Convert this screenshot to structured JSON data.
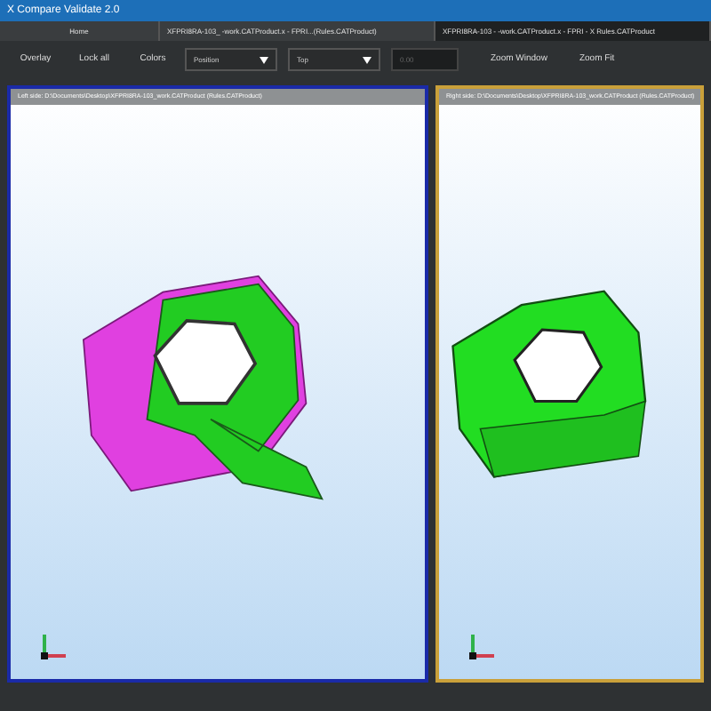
{
  "window": {
    "title": "X Compare Validate 2.0"
  },
  "tabs": [
    {
      "label": "Home",
      "selected": false
    },
    {
      "label": "XFPRI8RA-103_ -work.CATProduct.x - FPRI...(Rules.CATProduct)",
      "selected": false
    },
    {
      "label": "XFPRI8RA-103 - -work.CATProduct.x - FPRI - X Rules.CATProduct",
      "selected": true
    }
  ],
  "toolbar": {
    "overlay": "Overlay",
    "lock": "Lock all",
    "colors": "Colors",
    "mode_select": "Position",
    "view_select": "Top",
    "value_field": "0.00",
    "zoom_window": "Zoom Window",
    "zoom_fit": "Zoom Fit"
  },
  "panels": [
    {
      "path": "Left side: D:\\Documents\\Desktop\\XFPRI8RA-103_work.CATProduct (Rules.CATProduct)",
      "active": true,
      "kind": "overlay"
    },
    {
      "path": "Right side: D:\\Documents\\Desktop\\XFPRI8RA-103_work.CATProduct (Rules.CATProduct)",
      "active": false,
      "kind": "single"
    }
  ]
}
